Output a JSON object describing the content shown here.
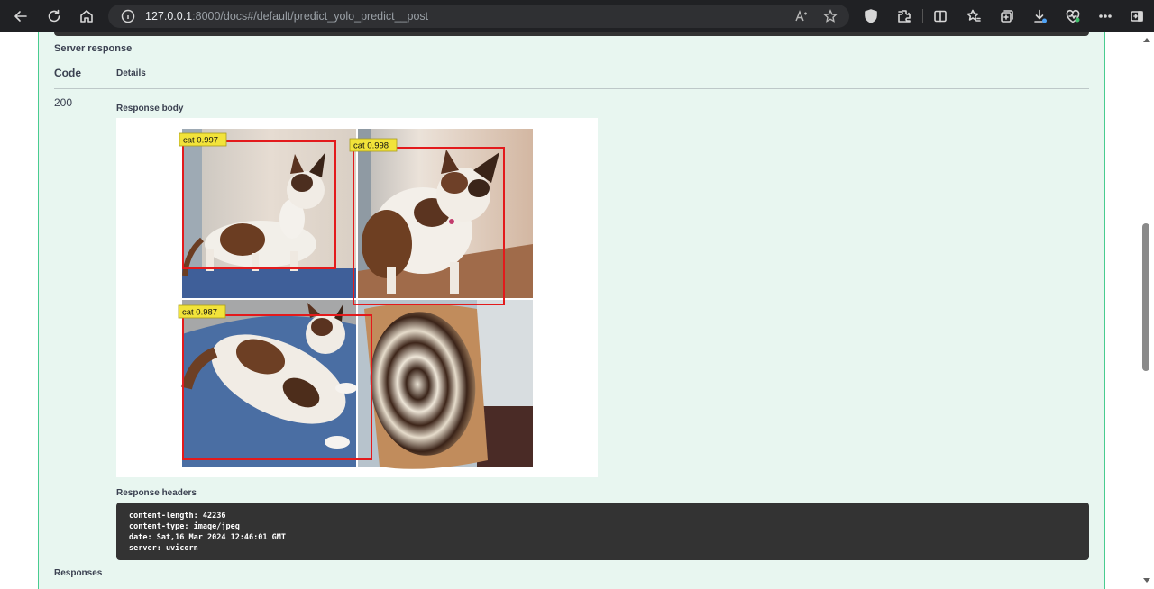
{
  "browser": {
    "url_host": "127.0.0.1",
    "url_rest": ":8000/docs#/default/predict_yolo_predict__post",
    "icons": [
      "back-icon",
      "refresh-icon",
      "home-icon",
      "info-icon",
      "read-aloud-icon",
      "favorite-star-icon",
      "shield-icon",
      "extensions-icon",
      "split-screen-icon",
      "favorites-icon",
      "collections-icon",
      "downloads-icon",
      "browser-essentials-icon",
      "more-icon",
      "sidebar-icon"
    ]
  },
  "response": {
    "server_response_title": "Server response",
    "code_header": "Code",
    "details_header": "Details",
    "status_code": "200",
    "body_label": "Response body",
    "detections": [
      {
        "label": "cat 0.997"
      },
      {
        "label": "cat 0.998"
      },
      {
        "label": "cat 0.987"
      }
    ],
    "headers_label": "Response headers",
    "headers": [
      "content-length: 42236",
      "content-type: image/jpeg",
      "date: Sat,16 Mar 2024 12:46:01 GMT",
      "server: uvicorn"
    ]
  },
  "responses_title": "Responses",
  "colors": {
    "operation_bg": "#e8f6f0",
    "operation_border": "#49cc90",
    "box_color": "#e31a1c",
    "label_bg": "#f2e33a",
    "code_block_bg": "#333333"
  }
}
